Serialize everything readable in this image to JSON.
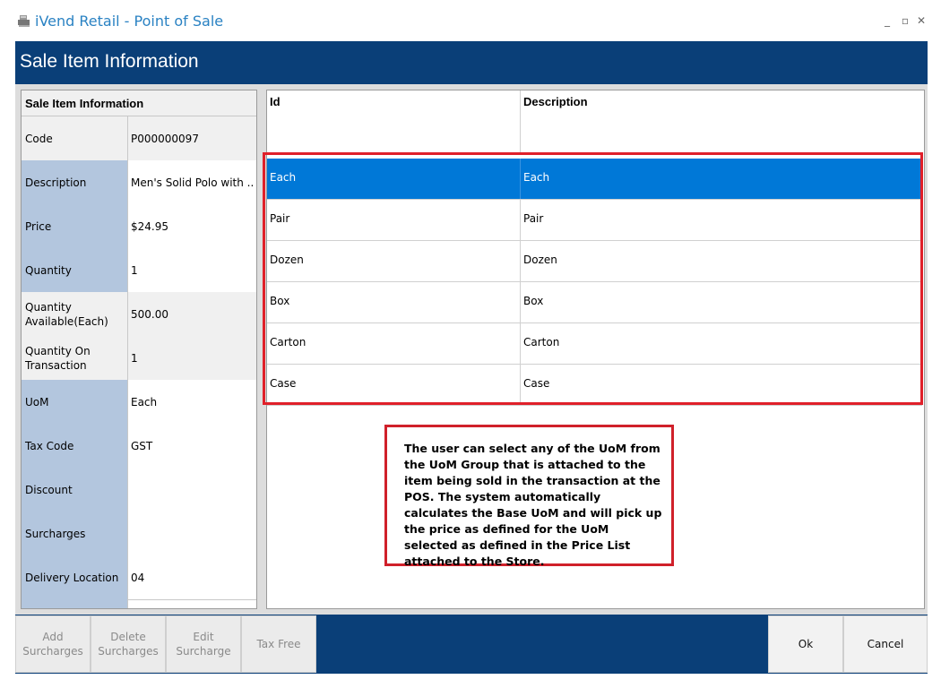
{
  "window": {
    "title": "iVend Retail - Point of Sale",
    "controls": {
      "minimize": "_",
      "maximize": "▫",
      "close": "✕"
    }
  },
  "header": {
    "title": "Sale Item Information"
  },
  "info_panel": {
    "heading": "Sale Item Information",
    "rows": [
      {
        "label": "Code",
        "value": "P000000097"
      },
      {
        "label": "Description",
        "value": "Men's Solid Polo with ..."
      },
      {
        "label": "Price",
        "value": "$24.95"
      },
      {
        "label": "Quantity",
        "value": "1"
      },
      {
        "label": "Quantity Available(Each)",
        "value": "500.00"
      },
      {
        "label": "Quantity On Transaction",
        "value": "1"
      },
      {
        "label": "UoM",
        "value": "Each"
      },
      {
        "label": "Tax Code",
        "value": "GST"
      },
      {
        "label": "Discount",
        "value": ""
      },
      {
        "label": "Surcharges",
        "value": ""
      },
      {
        "label": "Delivery Location",
        "value": "04"
      }
    ]
  },
  "uom_grid": {
    "columns": [
      "Id",
      "Description"
    ],
    "rows": [
      {
        "id": "Each",
        "description": "Each",
        "selected": true
      },
      {
        "id": "Pair",
        "description": "Pair"
      },
      {
        "id": "Dozen",
        "description": "Dozen"
      },
      {
        "id": "Box",
        "description": "Box"
      },
      {
        "id": "Carton",
        "description": "Carton"
      },
      {
        "id": "Case",
        "description": "Case"
      }
    ]
  },
  "callout": {
    "text": "The user can select any of the UoM from the UoM Group that is attached to the item being sold in the transaction at the POS. The system automatically calculates the Base UoM and will pick up the price as defined for the UoM selected as defined in the Price List attached to the Store."
  },
  "footer": {
    "add_surcharges_line1": "Add",
    "add_surcharges_line2": "Surcharges",
    "delete_surcharges_line1": "Delete",
    "delete_surcharges_line2": "Surcharges",
    "edit_surcharge_line1": "Edit",
    "edit_surcharge_line2": "Surcharge",
    "tax_free": "Tax Free",
    "ok": "Ok",
    "cancel": "Cancel"
  },
  "colors": {
    "header_bg": "#0a3f78",
    "selection": "#0078d7",
    "annotation_red": "#e0202a",
    "label_blue": "#b3c6de"
  }
}
